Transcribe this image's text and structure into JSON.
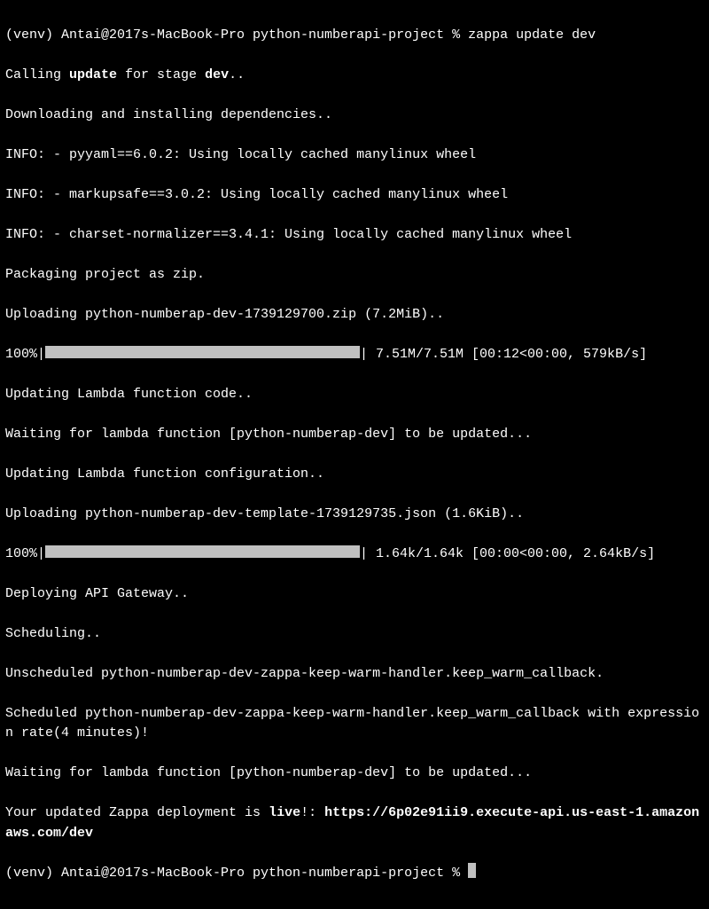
{
  "prompt1_prefix": "(venv) Antai@2017s-MacBook-Pro python-numberapi-project % ",
  "cmd": "zappa update dev",
  "l2a": "Calling ",
  "l2b": "update",
  "l2c": " for stage ",
  "l2d": "dev",
  "l2e": "..",
  "l3": "Downloading and installing dependencies..",
  "l4": "INFO: - pyyaml==6.0.2: Using locally cached manylinux wheel",
  "l5": "INFO: - markupsafe==3.0.2: Using locally cached manylinux wheel",
  "l6": "INFO: - charset-normalizer==3.4.1: Using locally cached manylinux wheel",
  "l7": "Packaging project as zip.",
  "l8": "Uploading python-numberap-dev-1739129700.zip (7.2MiB)..",
  "bar1_left": "100%|",
  "bar1_right": "| 7.51M/7.51M [00:12<00:00, 579kB/s]",
  "l10": "Updating Lambda function code..",
  "l11": "Waiting for lambda function [python-numberap-dev] to be updated...",
  "l12": "Updating Lambda function configuration..",
  "l13": "Uploading python-numberap-dev-template-1739129735.json (1.6KiB)..",
  "bar2_left": "100%|",
  "bar2_right": "| 1.64k/1.64k [00:00<00:00, 2.64kB/s]",
  "l15": "Deploying API Gateway..",
  "l16": "Scheduling..",
  "l17": "Unscheduled python-numberap-dev-zappa-keep-warm-handler.keep_warm_callback.",
  "l18": "Scheduled python-numberap-dev-zappa-keep-warm-handler.keep_warm_callback with expression rate(4 minutes)!",
  "l19": "Waiting for lambda function [python-numberap-dev] to be updated...",
  "l20a": "Your updated Zappa deployment is ",
  "l20b": "live",
  "l20c": "!: ",
  "l20d": "https://6p02e91ii9.execute-api.us-east-1.amazonaws.com/dev",
  "prompt2": "(venv) Antai@2017s-MacBook-Pro python-numberapi-project % "
}
